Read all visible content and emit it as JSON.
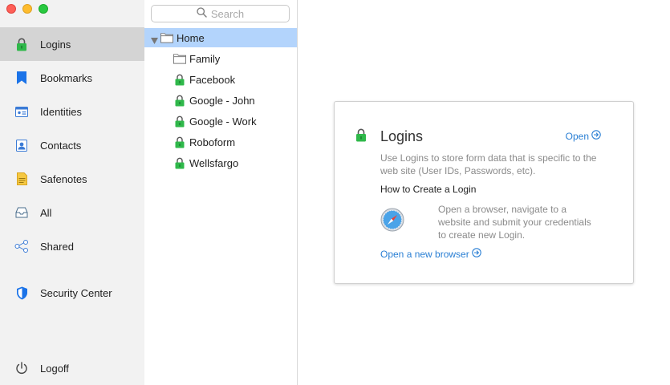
{
  "window": {
    "traffic_lights": [
      "close",
      "minimize",
      "zoom"
    ]
  },
  "sidebar": {
    "items": [
      {
        "label": "Logins",
        "icon": "lock-icon",
        "active": true
      },
      {
        "label": "Bookmarks",
        "icon": "bookmark-icon"
      },
      {
        "label": "Identities",
        "icon": "id-card-icon"
      },
      {
        "label": "Contacts",
        "icon": "contact-icon"
      },
      {
        "label": "Safenotes",
        "icon": "note-icon"
      },
      {
        "label": "All",
        "icon": "inbox-icon"
      },
      {
        "label": "Shared",
        "icon": "share-icon"
      },
      {
        "label": "Security Center",
        "icon": "shield-icon"
      },
      {
        "label": "Logoff",
        "icon": "power-icon"
      }
    ]
  },
  "search": {
    "placeholder": "Search"
  },
  "tree": {
    "root": {
      "label": "Home",
      "expanded": true
    },
    "items": [
      {
        "label": "Family",
        "type": "folder"
      },
      {
        "label": "Facebook",
        "type": "login"
      },
      {
        "label": "Google - John",
        "type": "login"
      },
      {
        "label": "Google - Work",
        "type": "login"
      },
      {
        "label": "Roboform",
        "type": "login"
      },
      {
        "label": "Wellsfargo",
        "type": "login"
      }
    ]
  },
  "card": {
    "title": "Logins",
    "open_label": "Open",
    "description": "Use Logins to store form data that is specific to the web site (User IDs, Passwords, etc).",
    "howto_title": "How to Create a Login",
    "steps": "Open a browser, navigate to a website and submit your credentials to create new Login.",
    "new_browser_label": "Open a new browser"
  },
  "colors": {
    "accent_link": "#2a7fd4",
    "selection": "#b3d4fc",
    "lock_green": "#2fb84a",
    "sidebar_active": "#d4d4d4"
  }
}
